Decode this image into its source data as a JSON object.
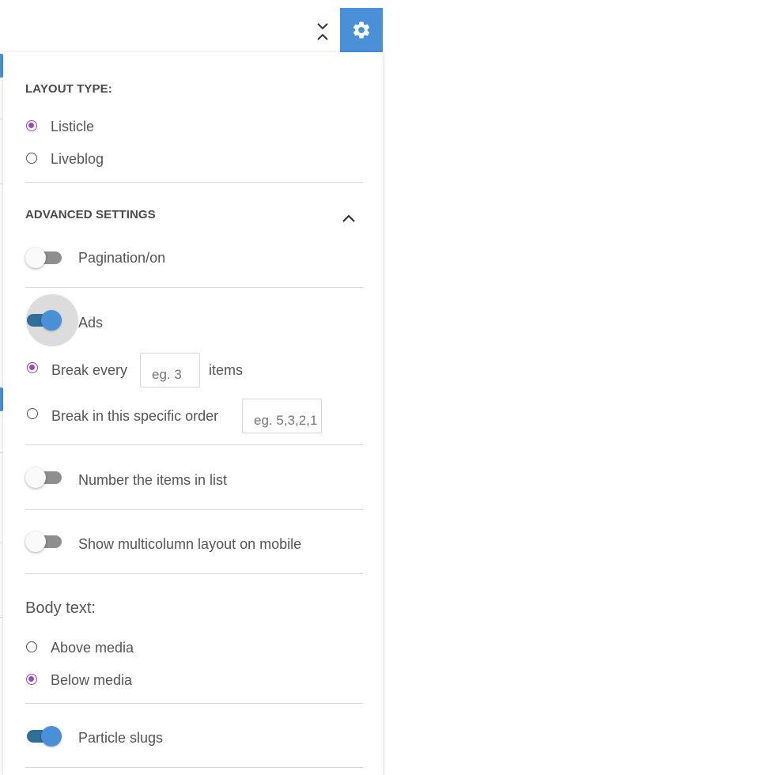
{
  "colors": {
    "accent": "#4a90d9",
    "radio_selected": "#9b45c8",
    "toggle_on_track": "#2f6e99",
    "toggle_off_track": "#8f8f8f"
  },
  "icons": {
    "collapse": "chevron-down-up-icon",
    "settings": "gear-icon",
    "section_toggle": "chevron-up-icon"
  },
  "layout_type": {
    "heading": "LAYOUT TYPE:",
    "options": [
      {
        "label": "Listicle",
        "selected": true
      },
      {
        "label": "Liveblog",
        "selected": false
      }
    ]
  },
  "advanced": {
    "heading": "ADVANCED SETTINGS",
    "expanded": true,
    "pagination": {
      "label": "Pagination/on",
      "enabled": false
    },
    "ads": {
      "label": "Ads",
      "enabled": true,
      "break_every": {
        "label": "Break every",
        "selected": true,
        "value": "",
        "placeholder": "eg. 3",
        "suffix": "items"
      },
      "break_order": {
        "label": "Break in this specific order",
        "selected": false,
        "value": "",
        "placeholder": "eg. 5,3,2,1"
      }
    },
    "number_items": {
      "label": "Number the items in list",
      "enabled": false
    },
    "multicolumn": {
      "label": "Show multicolumn layout on mobile",
      "enabled": false
    }
  },
  "body_text": {
    "heading": "Body text:",
    "options": [
      {
        "label": "Above media",
        "selected": false
      },
      {
        "label": "Below media",
        "selected": true
      }
    ]
  },
  "particle_slugs": {
    "label": "Particle slugs",
    "enabled": true
  }
}
